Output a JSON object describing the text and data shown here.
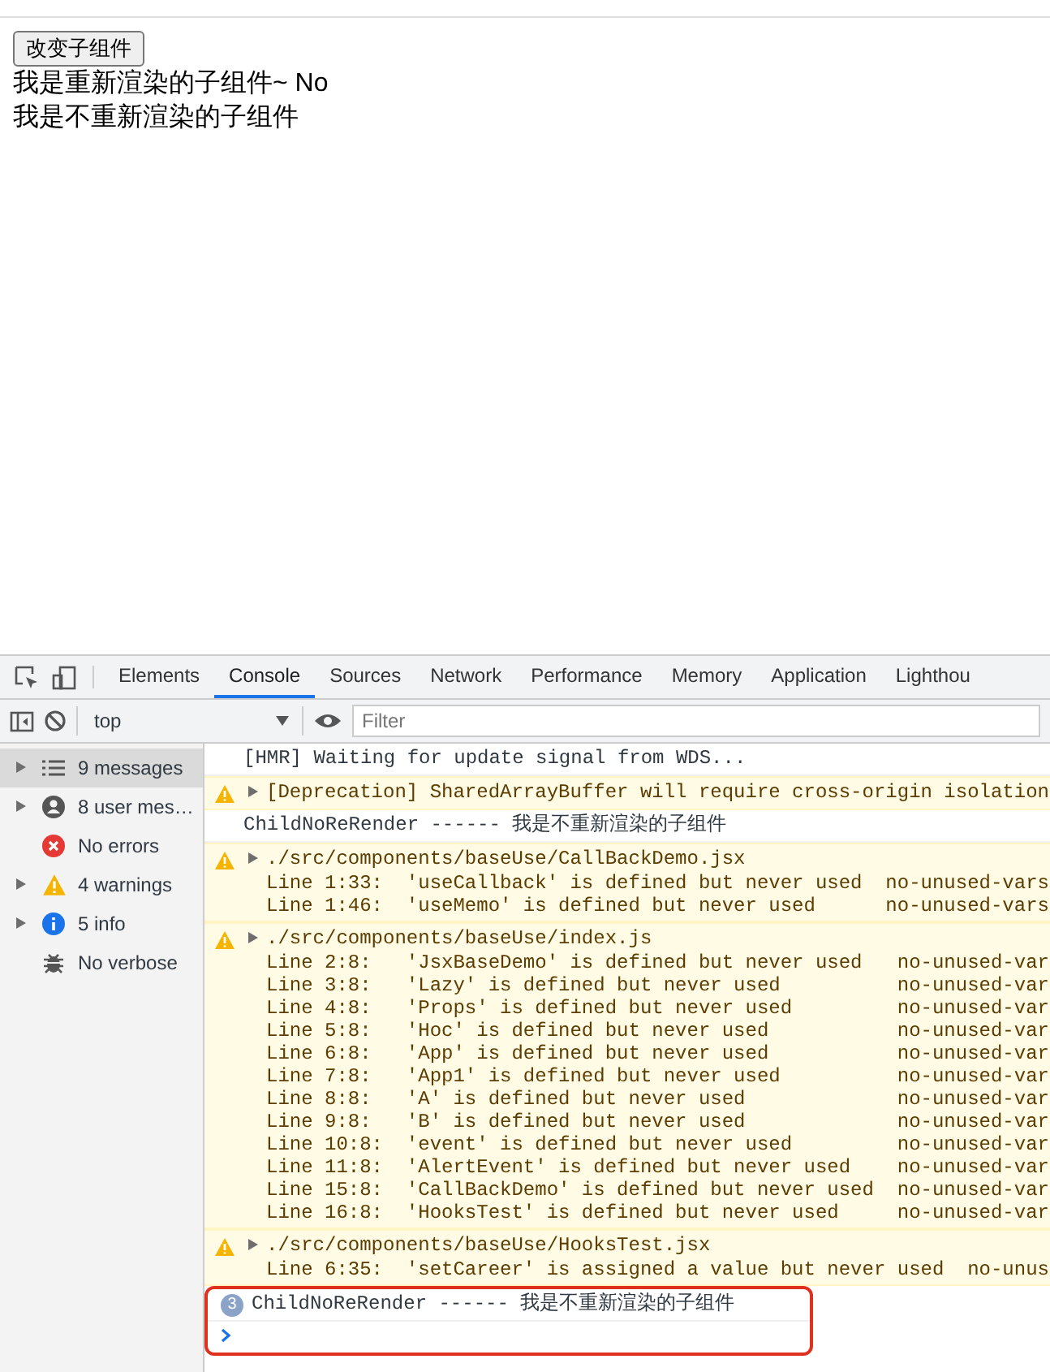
{
  "page": {
    "button": "改变子组件",
    "lines": [
      "我是重新渲染的子组件~ No",
      "我是不重新渲染的子组件"
    ]
  },
  "devtools": {
    "tabs": [
      {
        "label": "Elements",
        "selected": false
      },
      {
        "label": "Console",
        "selected": true
      },
      {
        "label": "Sources",
        "selected": false
      },
      {
        "label": "Network",
        "selected": false
      },
      {
        "label": "Performance",
        "selected": false
      },
      {
        "label": "Memory",
        "selected": false
      },
      {
        "label": "Application",
        "selected": false
      },
      {
        "label": "Lighthou",
        "selected": false
      }
    ],
    "toolbar": {
      "context": "top",
      "filter_placeholder": "Filter"
    },
    "sidebar": [
      {
        "kind": "messages",
        "label": "9 messages",
        "expandable": true,
        "selected": true
      },
      {
        "kind": "user",
        "label": "8 user mes…",
        "expandable": true,
        "selected": false
      },
      {
        "kind": "errors",
        "label": "No errors",
        "expandable": false,
        "selected": false
      },
      {
        "kind": "warnings",
        "label": "4 warnings",
        "expandable": true,
        "selected": false
      },
      {
        "kind": "info",
        "label": "5 info",
        "expandable": true,
        "selected": false
      },
      {
        "kind": "verbose",
        "label": "No verbose",
        "expandable": false,
        "selected": false
      }
    ],
    "messages": [
      {
        "kind": "log",
        "text": "[HMR] Waiting for update signal from WDS..."
      },
      {
        "kind": "warning",
        "text": "[Deprecation] SharedArrayBuffer will require cross-origin isolation"
      },
      {
        "kind": "log",
        "text": "ChildNoReRender ------ 我是不重新渲染的子组件"
      },
      {
        "kind": "warning",
        "text": "./src/components/baseUse/CallBackDemo.jsx",
        "lines": [
          "Line 1:33:  'useCallback' is defined but never used  no-unused-vars",
          "Line 1:46:  'useMemo' is defined but never used      no-unused-vars"
        ]
      },
      {
        "kind": "warning",
        "text": "./src/components/baseUse/index.js",
        "lines": [
          "Line 2:8:   'JsxBaseDemo' is defined but never used   no-unused-var",
          "Line 3:8:   'Lazy' is defined but never used          no-unused-var",
          "Line 4:8:   'Props' is defined but never used         no-unused-var",
          "Line 5:8:   'Hoc' is defined but never used           no-unused-var",
          "Line 6:8:   'App' is defined but never used           no-unused-var",
          "Line 7:8:   'App1' is defined but never used          no-unused-var",
          "Line 8:8:   'A' is defined but never used             no-unused-var",
          "Line 9:8:   'B' is defined but never used             no-unused-var",
          "Line 10:8:  'event' is defined but never used         no-unused-var",
          "Line 11:8:  'AlertEvent' is defined but never used    no-unused-var",
          "Line 15:8:  'CallBackDemo' is defined but never used  no-unused-var",
          "Line 16:8:  'HooksTest' is defined but never used     no-unused-var"
        ]
      },
      {
        "kind": "warning",
        "text": "./src/components/baseUse/HooksTest.jsx",
        "lines": [
          "Line 6:35:  'setCareer' is assigned a value but never used  no-unus"
        ]
      },
      {
        "kind": "log",
        "text": "ChildNoReRender ------ 我是不重新渲染的子组件",
        "count": "3",
        "highlighted": true
      }
    ]
  }
}
